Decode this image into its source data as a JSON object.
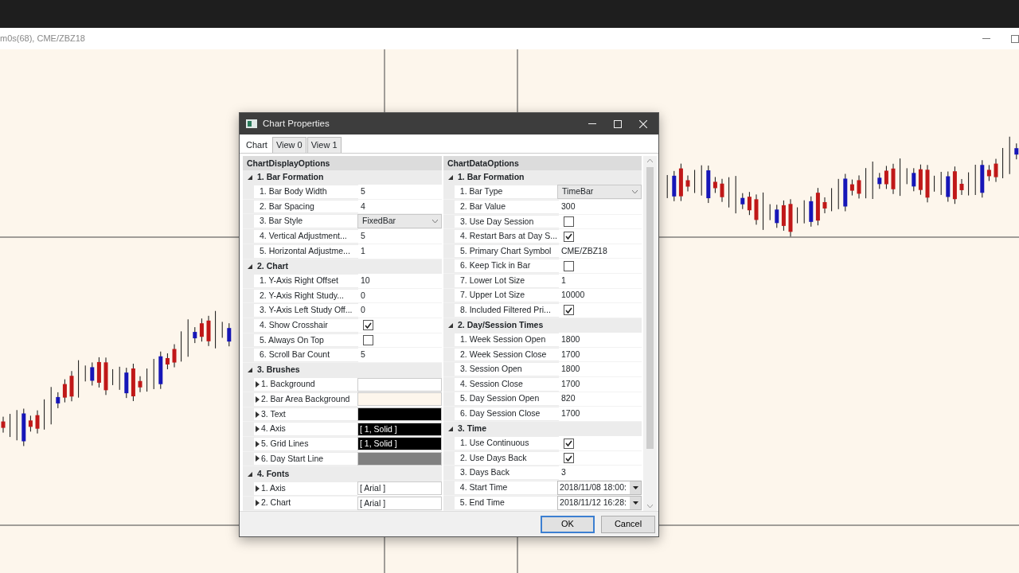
{
  "app": {
    "title": "m0s(68), CME/ZBZ18"
  },
  "dialog": {
    "title": "Chart Properties",
    "tabs": [
      {
        "label": "Chart",
        "selected": true
      },
      {
        "label": "View 0",
        "selected": false
      },
      {
        "label": "View 1",
        "selected": false
      }
    ],
    "panels": [
      {
        "title": "ChartDisplayOptions",
        "categories": [
          {
            "label": "1. Bar Formation",
            "expanded": true,
            "properties": [
              {
                "label": "1. Bar Body Width",
                "kind": "text",
                "value": "5"
              },
              {
                "label": "2. Bar Spacing",
                "kind": "text",
                "value": "4"
              },
              {
                "label": "3. Bar Style",
                "kind": "dropdown",
                "value": "FixedBar"
              },
              {
                "label": "4. Vertical Adjustment...",
                "kind": "text",
                "value": "5"
              },
              {
                "label": "5. Horizontal Adjustme...",
                "kind": "text",
                "value": "1"
              }
            ]
          },
          {
            "label": "2. Chart",
            "expanded": true,
            "properties": [
              {
                "label": "1. Y-Axis Right Offset",
                "kind": "text",
                "value": "10"
              },
              {
                "label": "2. Y-Axis Right Study...",
                "kind": "text",
                "value": "0"
              },
              {
                "label": "3. Y-Axis Left Study Off...",
                "kind": "text",
                "value": "0"
              },
              {
                "label": "4. Show Crosshair",
                "kind": "checkbox",
                "checked": true
              },
              {
                "label": "5. Always On Top",
                "kind": "checkbox",
                "checked": false
              },
              {
                "label": "6. Scroll Bar Count",
                "kind": "text",
                "value": "5"
              }
            ]
          },
          {
            "label": "3. Brushes",
            "expanded": true,
            "properties": [
              {
                "label": "1. Background",
                "kind": "color",
                "color": "#ffffff",
                "expanded": false
              },
              {
                "label": "2. Bar Area Background",
                "kind": "color",
                "color": "#fdf6ec",
                "expanded": false
              },
              {
                "label": "3. Text",
                "kind": "color",
                "color": "#000000",
                "expanded": false
              },
              {
                "label": "4. Axis",
                "kind": "color",
                "color": "#000000",
                "value": "[ 1, Solid ]",
                "expanded": false
              },
              {
                "label": "5. Grid Lines",
                "kind": "color",
                "color": "#000000",
                "value": "[ 1, Solid ]",
                "expanded": false
              },
              {
                "label": "6. Day Start Line",
                "kind": "color",
                "color": "#808080",
                "expanded": false
              }
            ]
          },
          {
            "label": "4. Fonts",
            "expanded": true,
            "properties": [
              {
                "label": "1. Axis",
                "kind": "font",
                "value": "[ Arial ]",
                "expanded": false
              },
              {
                "label": "2. Chart",
                "kind": "font",
                "value": "[ Arial ]",
                "expanded": false
              }
            ]
          }
        ]
      },
      {
        "title": "ChartDataOptions",
        "categories": [
          {
            "label": "1. Bar Formation",
            "expanded": true,
            "properties": [
              {
                "label": "1. Bar Type",
                "kind": "dropdown",
                "value": "TimeBar"
              },
              {
                "label": "2. Bar Value",
                "kind": "text",
                "value": "300"
              },
              {
                "label": "3. Use Day Session",
                "kind": "checkbox",
                "checked": false
              },
              {
                "label": "4. Restart Bars at Day S...",
                "kind": "checkbox",
                "checked": true
              },
              {
                "label": "5. Primary Chart Symbol",
                "kind": "text",
                "value": "CME/ZBZ18"
              },
              {
                "label": "6. Keep Tick in Bar",
                "kind": "checkbox",
                "checked": false
              },
              {
                "label": "7. Lower Lot Size",
                "kind": "text",
                "value": "1"
              },
              {
                "label": "7. Upper Lot Size",
                "kind": "text",
                "value": "10000"
              },
              {
                "label": "8. Included Filtered Pri...",
                "kind": "checkbox",
                "checked": true
              }
            ]
          },
          {
            "label": "2. Day/Session Times",
            "expanded": true,
            "properties": [
              {
                "label": "1. Week Session Open",
                "kind": "text",
                "value": "1800"
              },
              {
                "label": "2. Week Session Close",
                "kind": "text",
                "value": "1700"
              },
              {
                "label": "3. Session Open",
                "kind": "text",
                "value": "1800"
              },
              {
                "label": "4. Session Close",
                "kind": "text",
                "value": "1700"
              },
              {
                "label": "5. Day Session Open",
                "kind": "text",
                "value": "820"
              },
              {
                "label": "6. Day Session Close",
                "kind": "text",
                "value": "1700"
              }
            ]
          },
          {
            "label": "3. Time",
            "expanded": true,
            "properties": [
              {
                "label": "1. Use Continuous",
                "kind": "checkbox",
                "checked": true
              },
              {
                "label": "2. Use Days Back",
                "kind": "checkbox",
                "checked": true
              },
              {
                "label": "3. Days Back",
                "kind": "text",
                "value": "3"
              },
              {
                "label": "4. Start Time",
                "kind": "datetime",
                "value": "2018/11/08 18:00:"
              },
              {
                "label": "5. End Time",
                "kind": "datetime",
                "value": "2018/11/12 16:28:"
              }
            ]
          }
        ]
      }
    ],
    "buttons": [
      {
        "label": "OK",
        "kind": "default"
      },
      {
        "label": "Cancel",
        "kind": "normal"
      }
    ]
  }
}
